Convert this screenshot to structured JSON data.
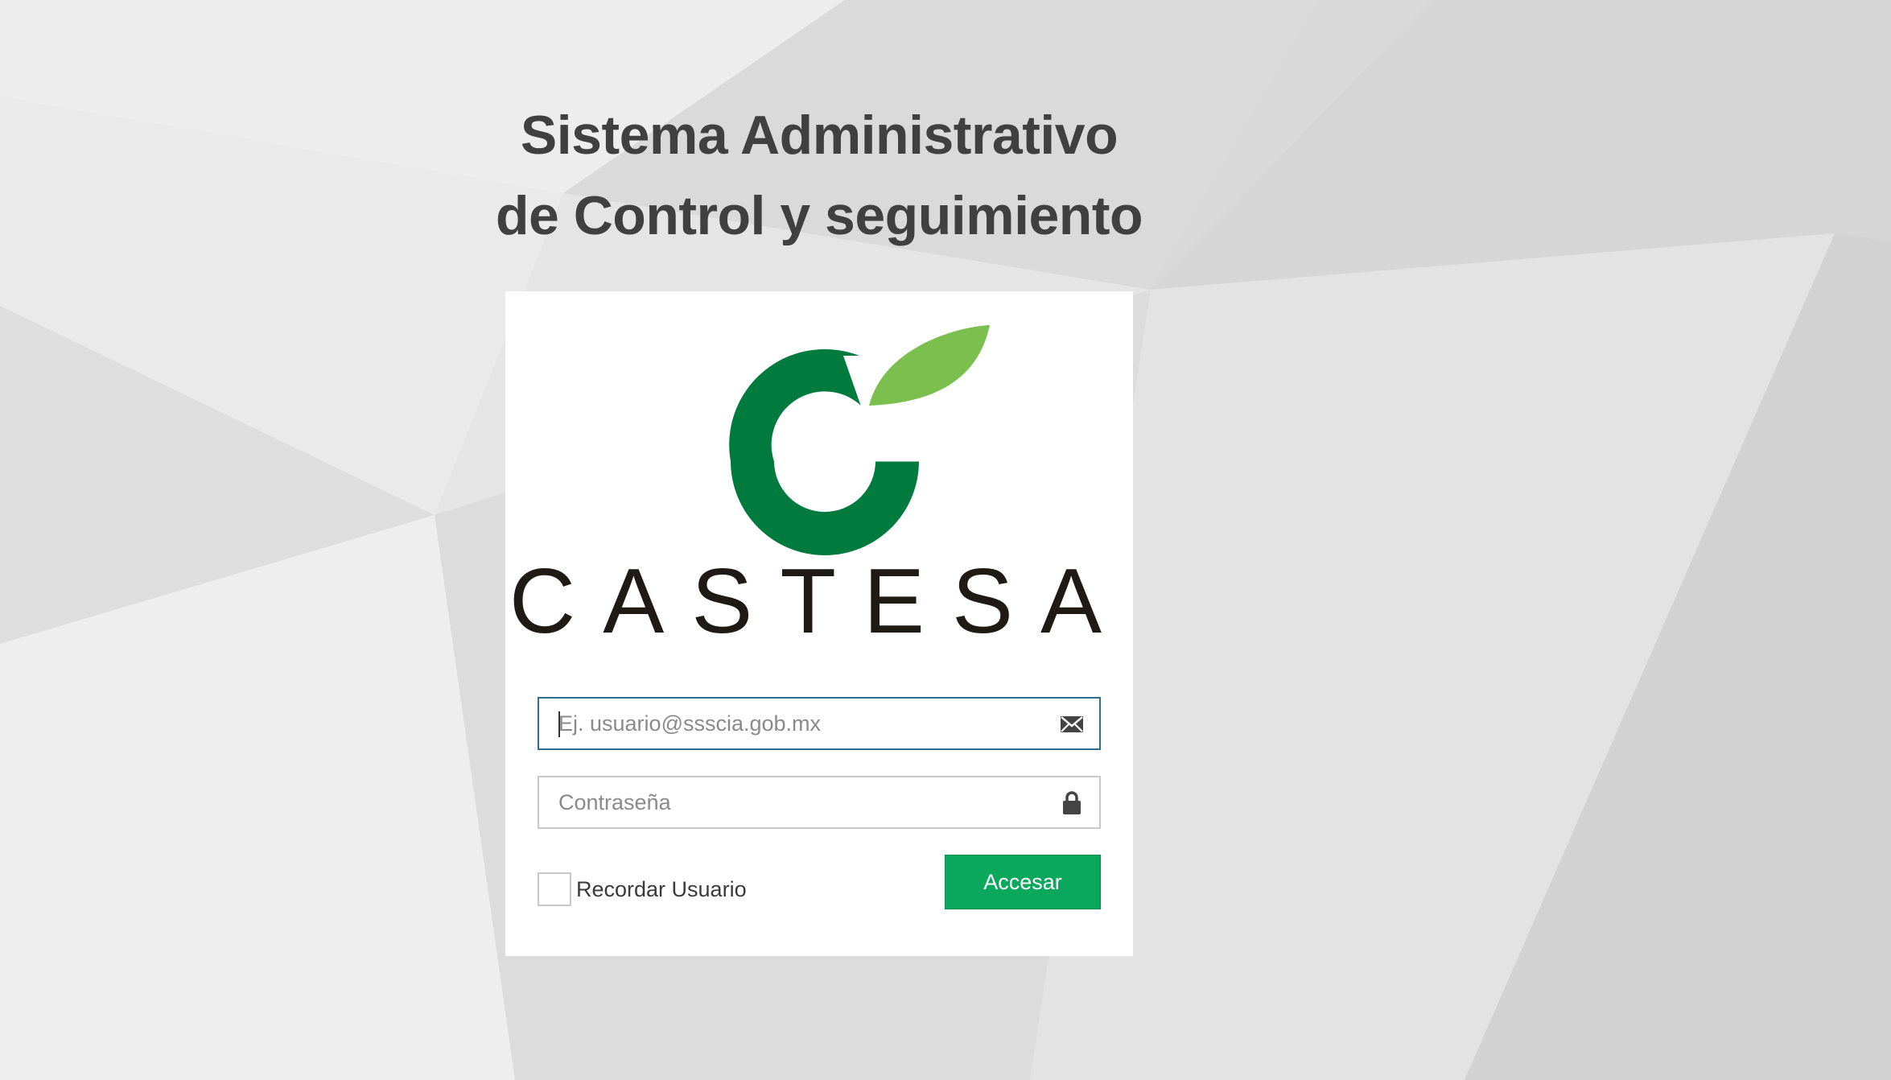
{
  "header": {
    "title_line1": "Sistema Administrativo",
    "title_line2": "de Control y seguimiento"
  },
  "logo": {
    "text": "CASTESA",
    "icon": "castesa-leaf-c-logo",
    "colors": {
      "dark_green": "#007a3d",
      "light_green": "#7bc04f",
      "text": "#1f1a14"
    }
  },
  "login_form": {
    "email": {
      "placeholder": "Ej. usuario@ssscia.gob.mx",
      "value": "",
      "icon": "envelope-icon"
    },
    "password": {
      "placeholder": "Contraseña",
      "value": "",
      "icon": "lock-icon"
    },
    "remember": {
      "label": "Recordar Usuario",
      "checked": false
    },
    "submit_label": "Accesar"
  },
  "colors": {
    "accent": "#0aa85c",
    "focus_border": "#2e6f8e",
    "title_text": "#404040",
    "background": "#e6e6e6"
  }
}
